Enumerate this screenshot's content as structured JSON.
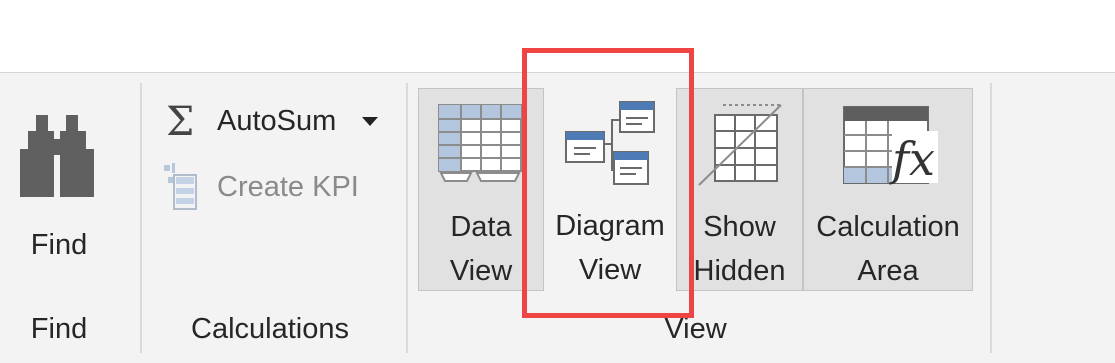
{
  "groups": {
    "find": {
      "label": "Find",
      "button": "Find",
      "icon": "binoculars-icon"
    },
    "calculations": {
      "label": "Calculations",
      "autosum": {
        "label": "AutoSum",
        "icon": "sigma-icon",
        "dropdown_icon": "caret-down-icon"
      },
      "create_kpi": {
        "label": "Create KPI",
        "icon": "kpi-icon",
        "disabled": true
      }
    },
    "view": {
      "label": "View",
      "buttons": [
        {
          "line1": "Data",
          "line2": "View",
          "icon": "data-view-icon",
          "pressed": true
        },
        {
          "line1": "Diagram",
          "line2": "View",
          "icon": "diagram-view-icon",
          "pressed": false
        },
        {
          "line1": "Show",
          "line2": "Hidden",
          "icon": "show-hidden-icon",
          "pressed": true
        },
        {
          "line1": "Calculation",
          "line2": "Area",
          "icon": "calculation-area-icon",
          "pressed": true
        }
      ]
    }
  },
  "colors": {
    "highlight": "#ee4444",
    "ribbon_bg": "#f3f3f3",
    "pressed_bg": "#e1e1e1",
    "accent_blue": "#4e7ab5"
  }
}
